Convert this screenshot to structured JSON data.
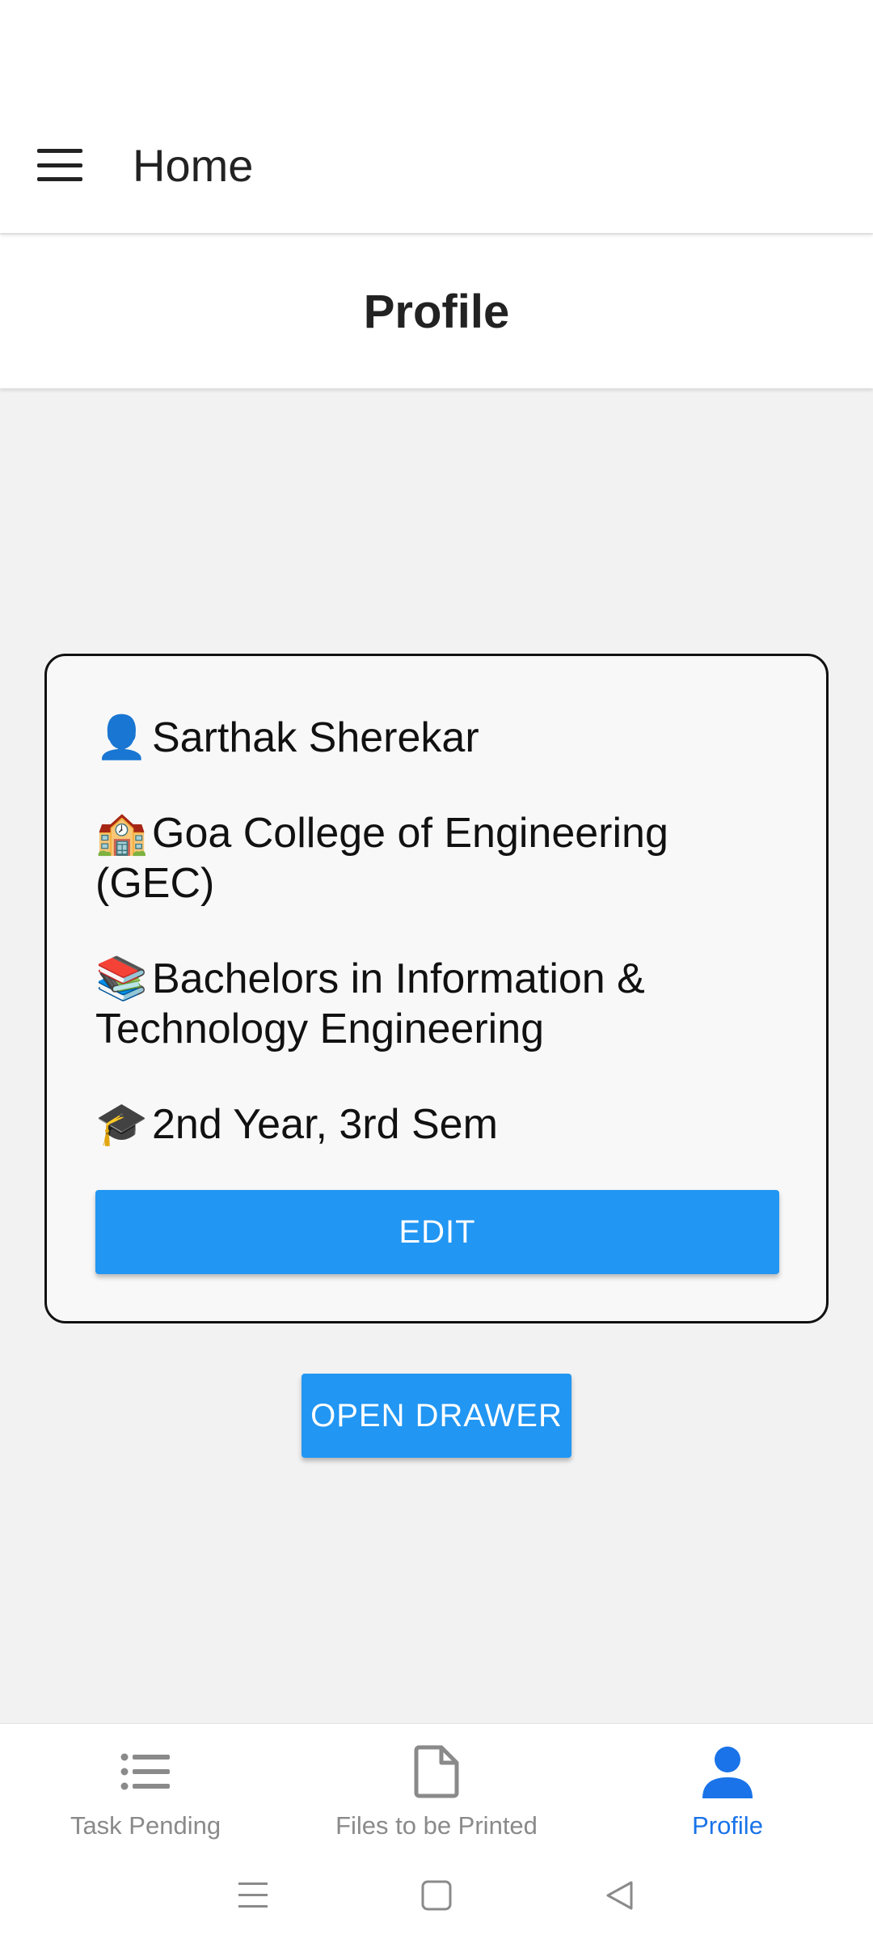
{
  "app_bar": {
    "title": "Home",
    "menu_icon": "hamburger-menu-icon"
  },
  "page": {
    "title": "Profile"
  },
  "profile_card": {
    "name": {
      "emoji": "👤",
      "text": "Sarthak Sherekar"
    },
    "college": {
      "emoji": "🏫",
      "text": "Goa College of Engineering (GEC)"
    },
    "degree": {
      "emoji": "📚",
      "text": "Bachelors in Information & Technology Engineering"
    },
    "year": {
      "emoji": "🎓",
      "text": "2nd Year, 3rd Sem"
    },
    "edit_label": "EDIT"
  },
  "open_drawer_label": "OPEN DRAWER",
  "bottom_nav": {
    "items": [
      {
        "label": "Task Pending",
        "icon": "list-icon",
        "active": false
      },
      {
        "label": "Files to be Printed",
        "icon": "file-icon",
        "active": false
      },
      {
        "label": "Profile",
        "icon": "person-icon",
        "active": true
      }
    ]
  },
  "system_nav": {
    "icons": [
      "recents-icon",
      "home-icon",
      "back-icon"
    ]
  },
  "colors": {
    "accent": "#2196f3",
    "active_nav": "#1a73e8",
    "inactive_nav": "#8a8a8a"
  }
}
